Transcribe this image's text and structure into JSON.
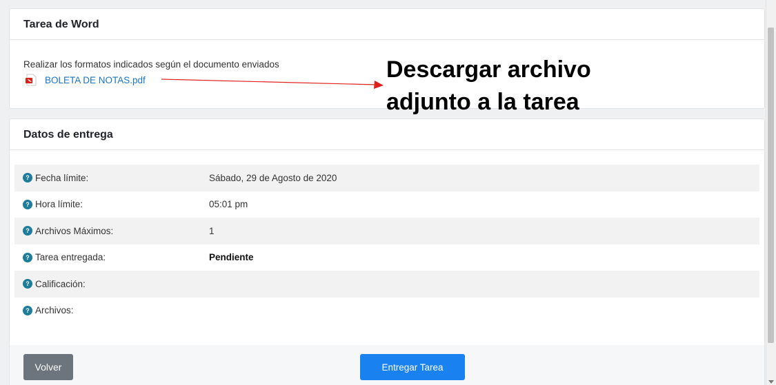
{
  "task": {
    "title": "Tarea de Word",
    "description": "Realizar los formatos indicados según el documento enviados",
    "attachment_name": "BOLETA DE NOTAS.pdf"
  },
  "annotation": {
    "line1": "Descargar archivo",
    "line2": "adjunto a la tarea",
    "color": "#e0201b"
  },
  "delivery": {
    "title": "Datos de entrega",
    "rows": [
      {
        "label": "Fecha límite:",
        "value": "Sábado, 29 de Agosto de 2020"
      },
      {
        "label": "Hora límite:",
        "value": "05:01 pm"
      },
      {
        "label": "Archivos Máximos:",
        "value": "1"
      },
      {
        "label": "Tarea entregada:",
        "value": "Pendiente"
      },
      {
        "label": "Calificación:",
        "value": ""
      },
      {
        "label": "Archivos:",
        "value": ""
      }
    ],
    "help_icon_glyph": "?"
  },
  "actions": {
    "back_label": "Volver",
    "submit_label": "Entregar Tarea"
  },
  "colors": {
    "link": "#1a73c8",
    "primary_button": "#1a82f0",
    "secondary_button": "#6c757d",
    "help_icon": "#1e7d9a"
  },
  "icons": {
    "attachment": "pdf-file-icon",
    "row_help": "question-circle-icon"
  }
}
